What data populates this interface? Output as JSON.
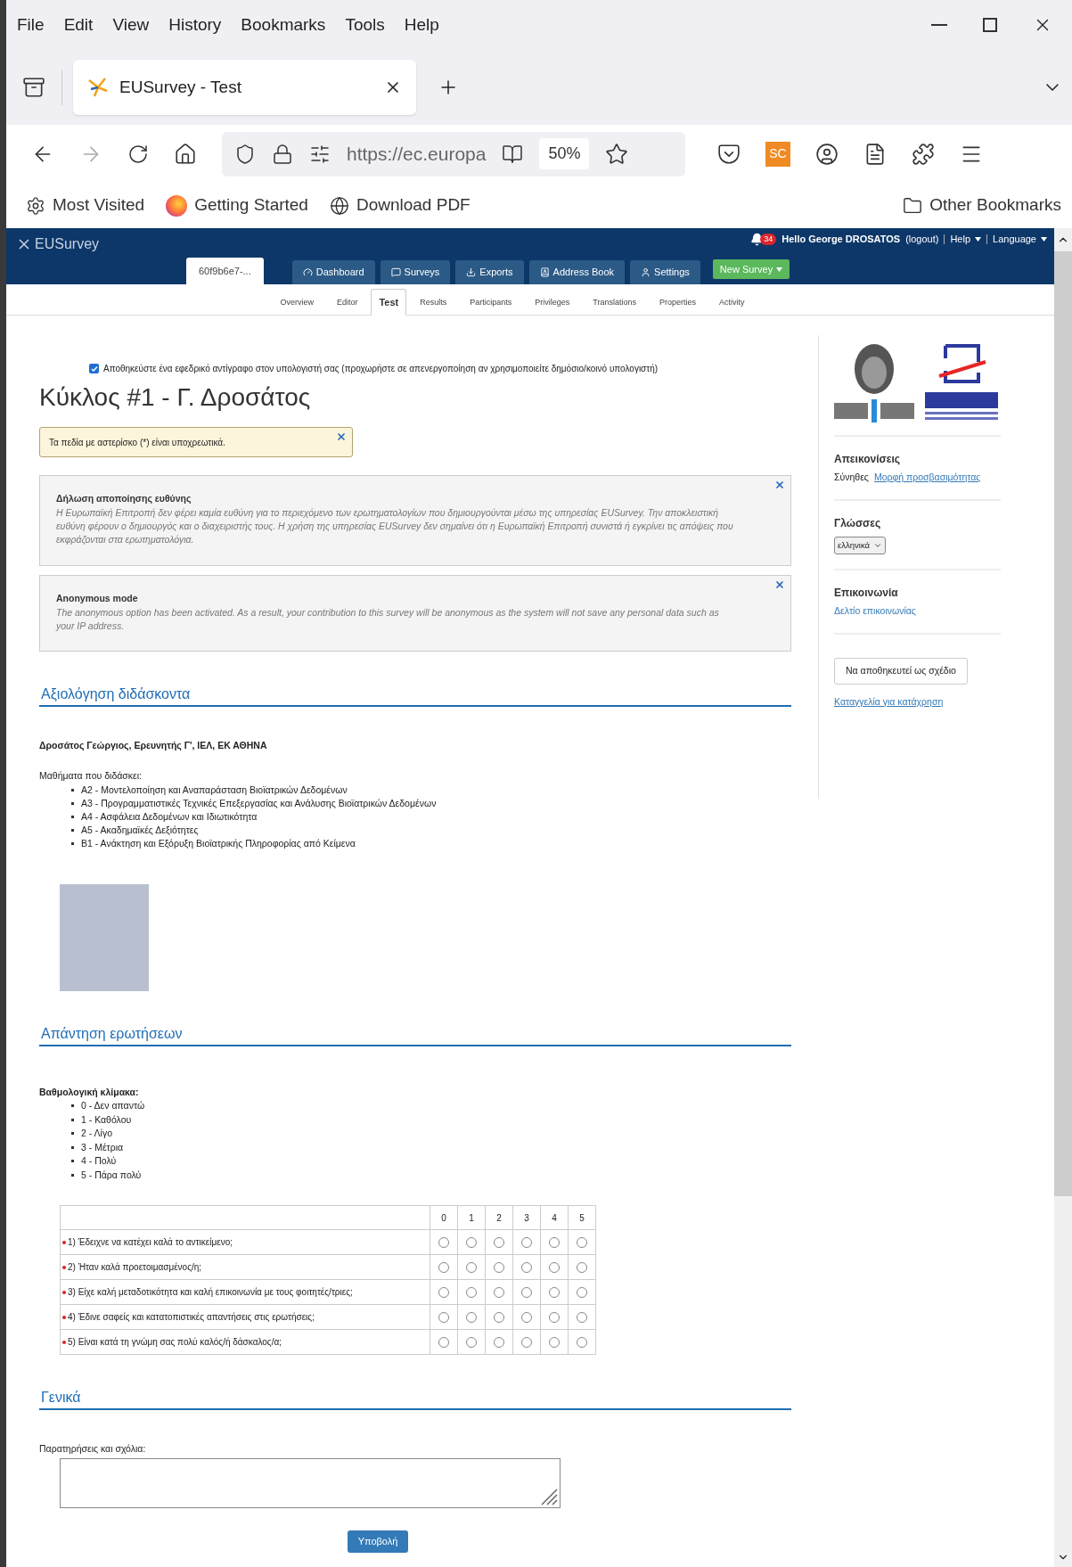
{
  "menu": [
    "File",
    "Edit",
    "View",
    "History",
    "Bookmarks",
    "Tools",
    "Help"
  ],
  "browser_tab": {
    "title": "EUSurvey - Test"
  },
  "address_bar": {
    "url": "https://ec.europa",
    "zoom": "50%",
    "extension": "SC"
  },
  "bookmarks": [
    "Most Visited",
    "Getting Started",
    "Download PDF"
  ],
  "other_bookmarks": "Other Bookmarks",
  "app_header": {
    "brand": "EUSurvey",
    "notifications": "34",
    "greeting": "Hello George DROSATOS",
    "logout": "(logout)",
    "help": "Help",
    "language": "Language"
  },
  "survey_tab": "60f9b6e7-...",
  "nav_buttons": [
    "Dashboard",
    "Surveys",
    "Exports",
    "Address Book",
    "Settings"
  ],
  "new_survey": "New Survey",
  "subtabs": [
    {
      "label": "Overview",
      "selected": false
    },
    {
      "label": "Editor",
      "selected": false
    },
    {
      "label": "Test",
      "selected": true
    },
    {
      "label": "Results",
      "selected": false
    },
    {
      "label": "Participants",
      "selected": false
    },
    {
      "label": "Privileges",
      "selected": false
    },
    {
      "label": "Translations",
      "selected": false
    },
    {
      "label": "Properties",
      "selected": false
    },
    {
      "label": "Activity",
      "selected": false
    }
  ],
  "backup": {
    "label": "Αποθηκεύστε ένα εφεδρικό αντίγραφο στον υπολογιστή σας (προχωρήστε σε απενεργοποίηση αν χρησιμοποιείτε δημόσιο/κοινό υπολογιστή)",
    "checked": true
  },
  "title": "Κύκλος #1 - Γ. Δροσάτος",
  "required_note": "Τα πεδία με αστερίσκο (*) είναι υποχρεωτικά.",
  "notices": [
    {
      "title": "Δήλωση αποποίησης ευθύνης",
      "body": "Η Ευρωπαϊκή Επιτροπή δεν φέρει καμία ευθύνη για το περιεχόμενο των ερωτηματολογίων που δημιουργούνται μέσω της υπηρεσίας EUSurvey. Την αποκλειστική ευθύνη φέρουν ο δημιουργός και ο διαχειριστής τους. Η χρήση της υπηρεσίας EUSurvey δεν σημαίνει ότι η Ευρωπαϊκή Επιτροπή συνιστά ή εγκρίνει τις απόψεις που εκφράζονται στα ερωτηματολόγια."
    },
    {
      "title": "Anonymous mode",
      "body": "The anonymous option has been activated. As a result, your contribution to this survey will be anonymous as the system will not save any personal data such as your IP address."
    }
  ],
  "section_1": {
    "heading": "Αξιολόγηση διδάσκοντα",
    "teacher": "Δροσάτος Γεώργιος, Ερευνητής Γ', ΙΕΛ, ΕΚ ΑΘΗΝΑ",
    "courses_label": "Μαθήματα που διδάσκει:",
    "courses": [
      "Α2 - Μοντελοποίηση και Αναπαράσταση Βιοϊατρικών Δεδομένων",
      "Α3 - Προγραμματιστικές Τεχνικές Επεξεργασίας και Ανάλυσης Βιοϊατρικών Δεδομένων",
      "Α4 - Ασφάλεια Δεδομένων και Ιδιωτικότητα",
      "Α5 - Ακαδημαϊκές Δεξιότητες",
      "Β1 - Ανάκτηση και Εξόρυξη Βιοϊατρικής Πληροφορίας από Κείμενα"
    ]
  },
  "section_2": {
    "heading": "Απάντηση ερωτήσεων",
    "scale_label": "Βαθμολογική κλίμακα:",
    "scale": [
      "0 - Δεν απαντώ",
      "1 - Καθόλου",
      "2 - Λίγο",
      "3 - Μέτρια",
      "4 - Πολύ",
      "5 - Πάρα πολύ"
    ],
    "columns": [
      "0",
      "1",
      "2",
      "3",
      "4",
      "5"
    ],
    "rows": [
      {
        "question": "1) Έδειχνε να κατέχει καλά το αντικείμενο;",
        "required": true,
        "choices": [
          {
            "selected": false
          },
          {
            "selected": false
          },
          {
            "selected": false
          },
          {
            "selected": false
          },
          {
            "selected": false
          },
          {
            "selected": false
          }
        ]
      },
      {
        "question": "2) Ήταν καλά προετοιμασμένος/η;",
        "required": true,
        "choices": [
          {
            "selected": false
          },
          {
            "selected": false
          },
          {
            "selected": false
          },
          {
            "selected": false
          },
          {
            "selected": false
          },
          {
            "selected": false
          }
        ]
      },
      {
        "question": "3) Είχε καλή μεταδοτικότητα και καλή επικοινωνία με τους φοιτητές/τριες;",
        "required": true,
        "choices": [
          {
            "selected": false
          },
          {
            "selected": false
          },
          {
            "selected": false
          },
          {
            "selected": false
          },
          {
            "selected": false
          },
          {
            "selected": false
          }
        ]
      },
      {
        "question": "4) Έδινε σαφείς και κατατοπιστικές απαντήσεις στις ερωτήσεις;",
        "required": true,
        "choices": [
          {
            "selected": false
          },
          {
            "selected": false
          },
          {
            "selected": false
          },
          {
            "selected": false
          },
          {
            "selected": false
          },
          {
            "selected": false
          }
        ]
      },
      {
        "question": "5) Είναι κατά τη γνώμη σας πολύ καλός/ή δάσκαλος/α;",
        "required": true,
        "choices": [
          {
            "selected": false
          },
          {
            "selected": false
          },
          {
            "selected": false
          },
          {
            "selected": false
          },
          {
            "selected": false
          },
          {
            "selected": false
          }
        ]
      }
    ]
  },
  "section_3": {
    "heading": "Γενικά",
    "comments_label": "Παρατηρήσεις και σχόλια:",
    "submit": "Υποβολή"
  },
  "sidebar": {
    "display_heading": "Απεικονίσεις",
    "display_standard": "Σύνηθες",
    "display_accessible": "Μορφή προσβασιμότητας",
    "languages_heading": "Γλώσσες",
    "language": "ελληνικά",
    "contact_heading": "Επικοινωνία",
    "contact_link": "Δελτίο επικοινωνίας",
    "save_draft": "Να αποθηκευτεί ως σχέδιο",
    "report": "Καταγγελία για κατάχρηση"
  }
}
